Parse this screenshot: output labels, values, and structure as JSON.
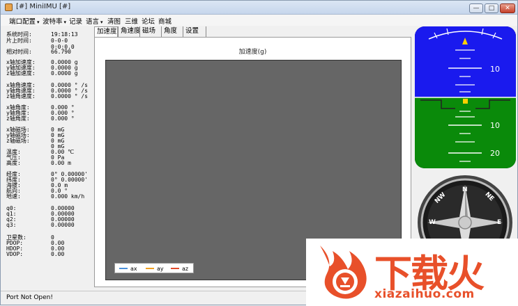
{
  "window": {
    "title": "[#] MiniIMU [#]",
    "min_glyph": "—",
    "max_glyph": "□",
    "close_glyph": "✕"
  },
  "menu": {
    "items": [
      {
        "label": "端口配置",
        "has_dropdown": true
      },
      {
        "label": "波特率",
        "has_dropdown": true
      },
      {
        "label": "记录",
        "has_dropdown": false
      },
      {
        "label": "语言",
        "has_dropdown": true
      },
      {
        "label": "清图",
        "has_dropdown": false
      },
      {
        "label": "三维",
        "has_dropdown": false
      },
      {
        "label": "论坛",
        "has_dropdown": false
      },
      {
        "label": "商城",
        "has_dropdown": false
      }
    ],
    "caret": "▾"
  },
  "readings": [
    {
      "label": "系统时间:",
      "value": "19:18:13"
    },
    {
      "label": "片上时间:",
      "value": "0-0-0"
    },
    {
      "label": "",
      "value": "0:0:0.0"
    },
    {
      "label": "相对时间:",
      "value": "66.790"
    },
    {
      "label": "x轴加速度:",
      "value": "0.0000 g"
    },
    {
      "label": "y轴加速度:",
      "value": "0.0000 g"
    },
    {
      "label": "z轴加速度:",
      "value": "0.0000 g"
    },
    {
      "label": "x轴角速度:",
      "value": "0.0000 ° /s"
    },
    {
      "label": "y轴角速度:",
      "value": "0.0000 ° /s"
    },
    {
      "label": "z轴角速度:",
      "value": "0.0000 ° /s"
    },
    {
      "label": "x轴角度:",
      "value": "0.000 °"
    },
    {
      "label": "y轴角度:",
      "value": "0.000 °"
    },
    {
      "label": "z轴角度:",
      "value": "0.000 °"
    },
    {
      "label": "x轴磁场:",
      "value": "0 mG"
    },
    {
      "label": "y轴磁场:",
      "value": "0 mG"
    },
    {
      "label": "z轴磁场:",
      "value": "0 mG"
    },
    {
      "label": "",
      "value": "0 mG"
    },
    {
      "label": "温度:",
      "value": "0.00 ℃"
    },
    {
      "label": "气压:",
      "value": "0 Pa"
    },
    {
      "label": "高度:",
      "value": "0.00 m"
    },
    {
      "label": "经度:",
      "value": "0° 0.00000'"
    },
    {
      "label": "纬度:",
      "value": "0° 0.00000'"
    },
    {
      "label": "海拔:",
      "value": "0.0 m"
    },
    {
      "label": "航向:",
      "value": "0.0 °"
    },
    {
      "label": "地速:",
      "value": "0.000 km/h"
    },
    {
      "label": "q0:",
      "value": "0.00000"
    },
    {
      "label": "q1:",
      "value": "0.00000"
    },
    {
      "label": "q2:",
      "value": "0.00000"
    },
    {
      "label": "q3:",
      "value": "0.00000"
    },
    {
      "label": "卫星数:",
      "value": "0"
    },
    {
      "label": "PDOP:",
      "value": "0.00"
    },
    {
      "label": "HDOP:",
      "value": "0.00"
    },
    {
      "label": "VDOP:",
      "value": "0.00"
    }
  ],
  "tabs": [
    {
      "label": "加速度",
      "active": true
    },
    {
      "label": "角速度",
      "active": false
    },
    {
      "label": "磁场",
      "active": false
    },
    {
      "label": "角度",
      "active": false
    },
    {
      "label": "设置",
      "active": false
    }
  ],
  "chart": {
    "title": "加速度(g)",
    "plot_bg": "#666666",
    "legend": [
      {
        "name": "ax",
        "color": "#4a90d9"
      },
      {
        "name": "ay",
        "color": "#f0a020"
      },
      {
        "name": "az",
        "color": "#e04a2a"
      }
    ]
  },
  "attitude": {
    "sky_color": "#1a1aee",
    "ground_color": "#0a8a0a",
    "scale_up": "10",
    "scale_down_1": "10",
    "scale_down_2": "20"
  },
  "compass": {
    "labels": [
      "N",
      "NE",
      "E",
      "W",
      "NW"
    ]
  },
  "status": {
    "text": "Port Not Open!"
  },
  "watermark": {
    "cn": "下载火",
    "url": "xiazaihuo.com"
  }
}
